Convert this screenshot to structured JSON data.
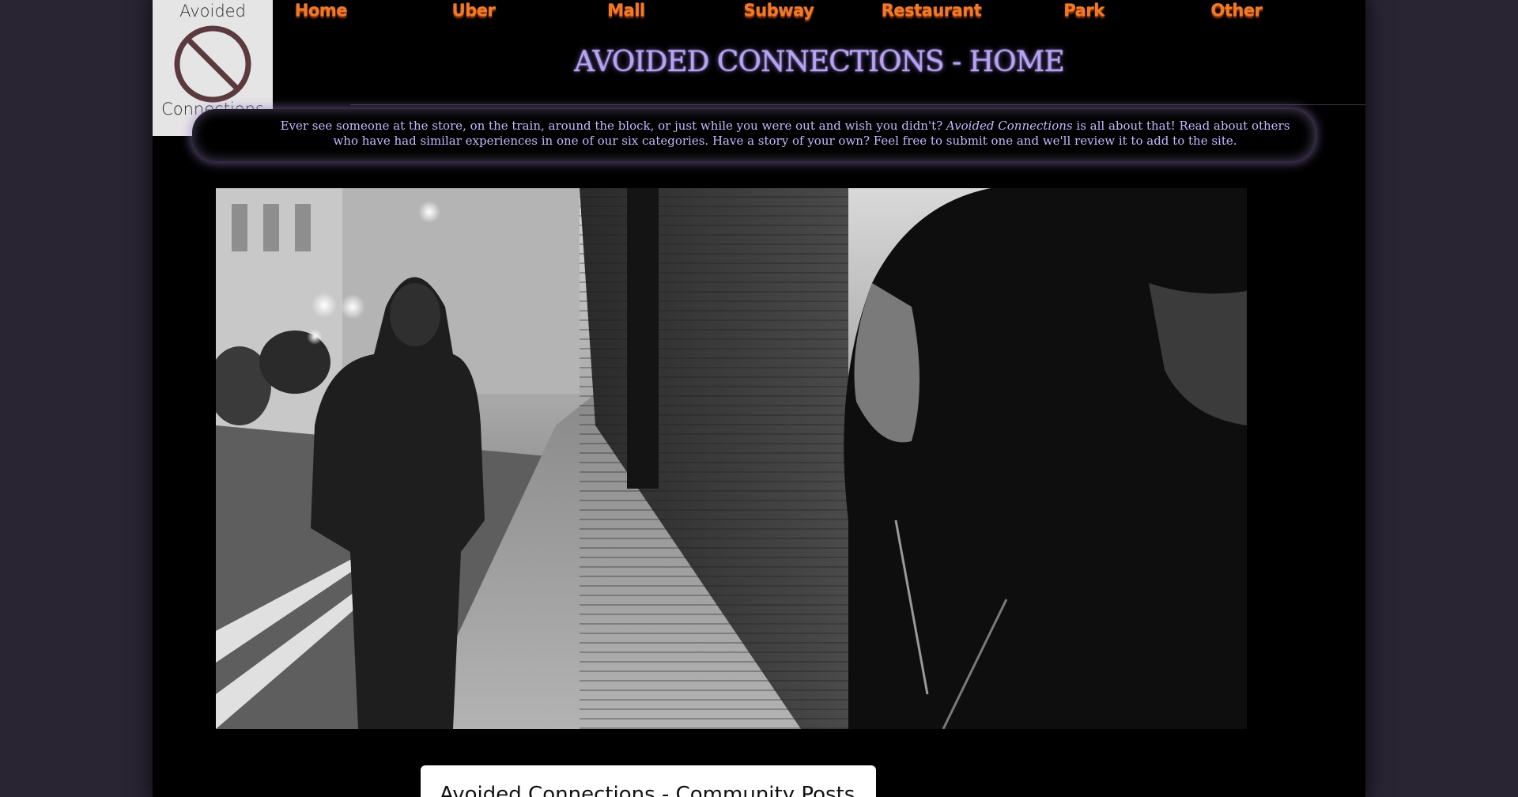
{
  "logo": {
    "top_text": "Avoided",
    "bottom_text": "Connections",
    "icon": "prohibited-icon",
    "color": "#5a3a3e"
  },
  "nav": {
    "items": [
      {
        "label": "Home"
      },
      {
        "label": "Uber"
      },
      {
        "label": "Mall"
      },
      {
        "label": "Subway"
      },
      {
        "label": "Restaurant"
      },
      {
        "label": "Park"
      },
      {
        "label": "Other"
      }
    ],
    "color": "#f07a2a"
  },
  "header": {
    "title": "AVOIDED CONNECTIONS - HOME",
    "color": "#b7a3f5"
  },
  "intro": {
    "text_before": "Ever see someone at the store, on the train, around the block, or just while you were out and wish you didn't? ",
    "brand": "Avoided Connections",
    "text_after": " is all about that! Read about others who have had similar experiences in one of our six categories. Have a story of your own? Feel free to submit one and we'll review it to add to the site."
  },
  "hero": {
    "subject": "hooded-figure-on-sidewalk-photo"
  },
  "posts": {
    "title": "Avoided Connections - Community Posts"
  }
}
